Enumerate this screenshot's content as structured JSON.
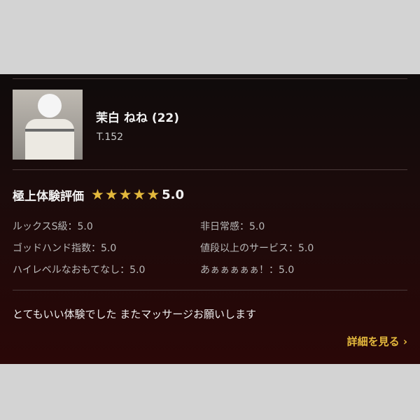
{
  "profile": {
    "name": "茉白 ねね (22)",
    "height": "T.152"
  },
  "rating": {
    "title": "極上体験評価",
    "stars": 5,
    "score": "5.0",
    "star_color": "#e3b83c"
  },
  "attributes": [
    "ルックスS級：5.0",
    "非日常感：5.0",
    "ゴッドハンド指数：5.0",
    "値段以上のサービス：5.0",
    "ハイレベルなおもてなし：5.0",
    "あぁぁぁぁぁ！：5.0"
  ],
  "comment": "とてもいい体験でした またマッサージお願いします",
  "detail_link": "詳細を見る ›",
  "colors": {
    "page_background": "#d3d3d3",
    "card_background": "#1b0b0b",
    "accent": "#e3b83c"
  }
}
